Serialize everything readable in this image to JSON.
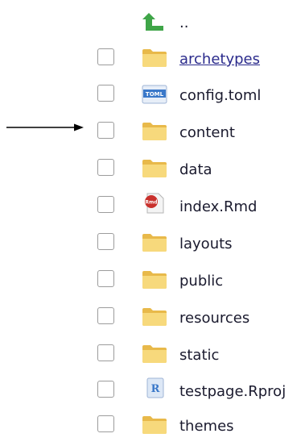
{
  "parent_link": {
    "label": ".."
  },
  "files": [
    {
      "name": "archetypes",
      "type": "folder",
      "link": true
    },
    {
      "name": "config.toml",
      "type": "toml",
      "badge": "TOML"
    },
    {
      "name": "content",
      "type": "folder"
    },
    {
      "name": "data",
      "type": "folder"
    },
    {
      "name": "index.Rmd",
      "type": "rmd",
      "badge": "Rmd"
    },
    {
      "name": "layouts",
      "type": "folder"
    },
    {
      "name": "public",
      "type": "folder"
    },
    {
      "name": "resources",
      "type": "folder"
    },
    {
      "name": "static",
      "type": "folder"
    },
    {
      "name": "testpage.Rproj",
      "type": "rproj",
      "badge": "R"
    },
    {
      "name": "themes",
      "type": "folder"
    }
  ],
  "colors": {
    "folder": "#f3cf6b",
    "up_arrow": "#3fa548",
    "link": "#2b2b8c",
    "toml": "#3a78c9",
    "rmd": "#c9302c",
    "rproj": "#3a78c9"
  }
}
